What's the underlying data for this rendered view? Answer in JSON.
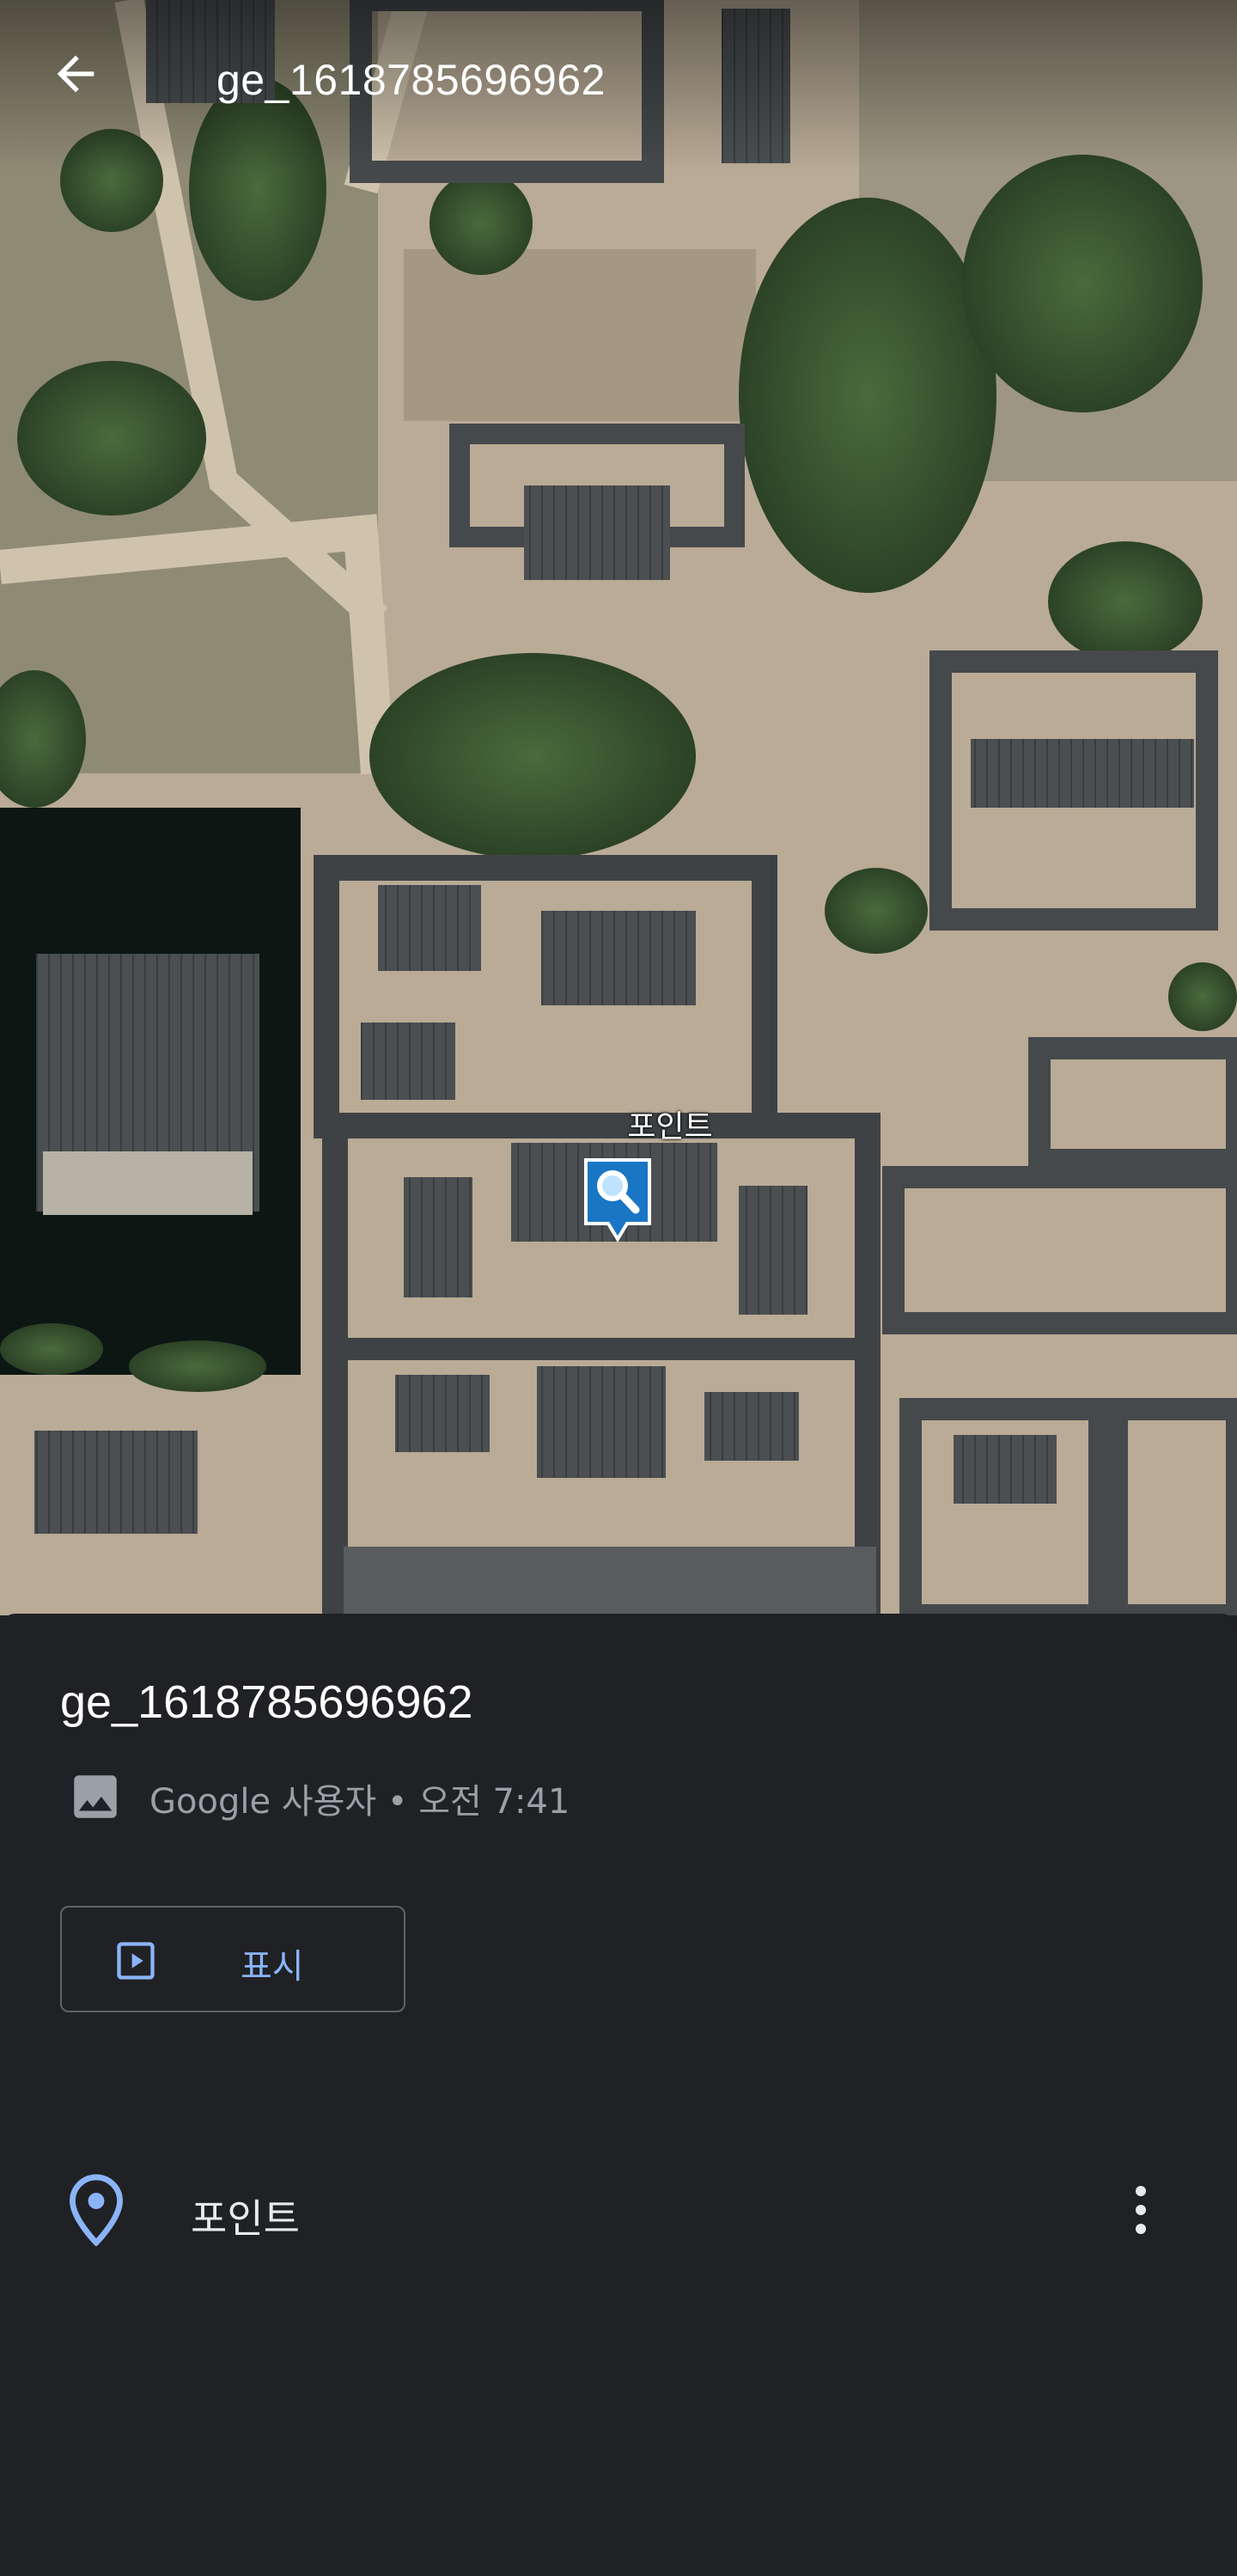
{
  "header": {
    "title": "ge_1618785696962",
    "back_icon": "arrow-back-icon"
  },
  "map": {
    "type": "satellite",
    "placemark": {
      "label": "포인트",
      "icon": "magnifier-placemark-icon"
    }
  },
  "sheet": {
    "title": "ge_1618785696962",
    "meta": {
      "icon": "image-icon",
      "text": "Google 사용자 • 오전 7:41"
    },
    "present_button": {
      "label": "표시",
      "icon": "present-play-icon"
    },
    "features": [
      {
        "label": "포인트",
        "icon": "location-pin-icon",
        "menu_icon": "more-vert-icon"
      }
    ]
  },
  "colors": {
    "sheet_background": "#202124",
    "accent": "#8ab4f8",
    "marker": "#1976c4",
    "text_primary": "#ffffff",
    "text_secondary": "#9aa0a6"
  }
}
